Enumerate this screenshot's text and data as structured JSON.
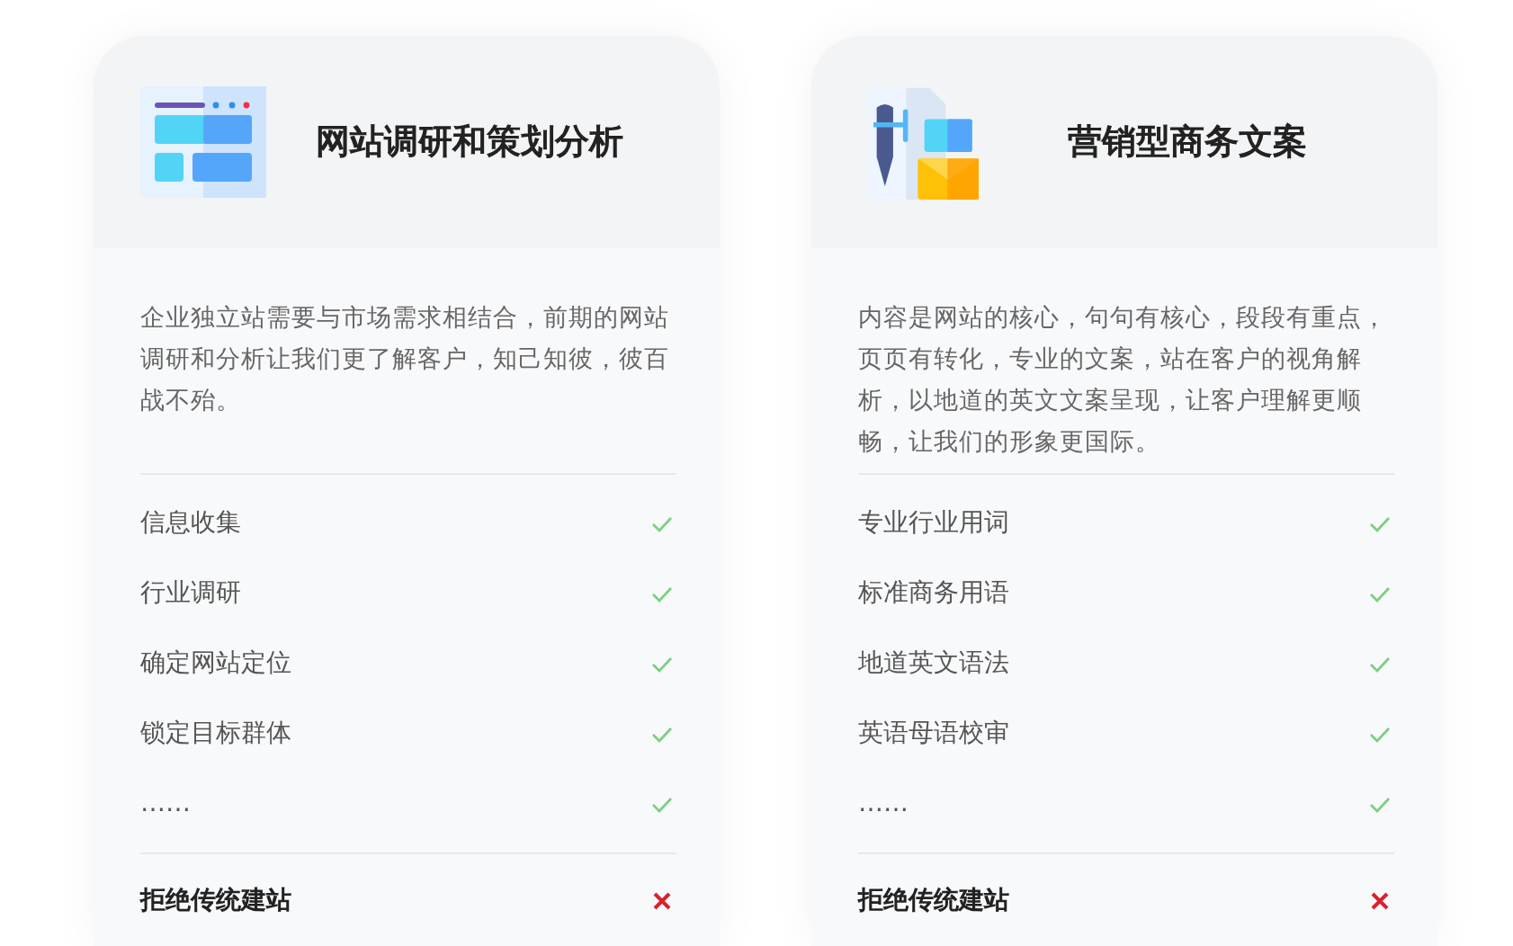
{
  "cards": [
    {
      "kind": "layout",
      "title": "网站调研和策划分析",
      "description": "企业独立站需要与市场需求相结合，前期的网站调研和分析让我们更了解客户，知己知彼，彼百战不殆。",
      "features": [
        {
          "label": "信息收集",
          "kind": "check"
        },
        {
          "label": "行业调研",
          "kind": "check"
        },
        {
          "label": "确定网站定位",
          "kind": "check"
        },
        {
          "label": "锁定目标群体",
          "kind": "check"
        },
        {
          "label": "……",
          "kind": "check"
        }
      ],
      "footer": {
        "label": "拒绝传统建站",
        "kind": "cross"
      }
    },
    {
      "kind": "writing",
      "title": "营销型商务文案",
      "description": "内容是网站的核心，句句有核心，段段有重点，页页有转化，专业的文案，站在客户的视角解析，以地道的英文文案呈现，让客户理解更顺畅，让我们的形象更国际。",
      "features": [
        {
          "label": "专业行业用词",
          "kind": "check"
        },
        {
          "label": "标准商务用语",
          "kind": "check"
        },
        {
          "label": "地道英文语法",
          "kind": "check"
        },
        {
          "label": "英语母语校审",
          "kind": "check"
        },
        {
          "label": "……",
          "kind": "check"
        }
      ],
      "footer": {
        "label": "拒绝传统建站",
        "kind": "cross"
      }
    }
  ]
}
